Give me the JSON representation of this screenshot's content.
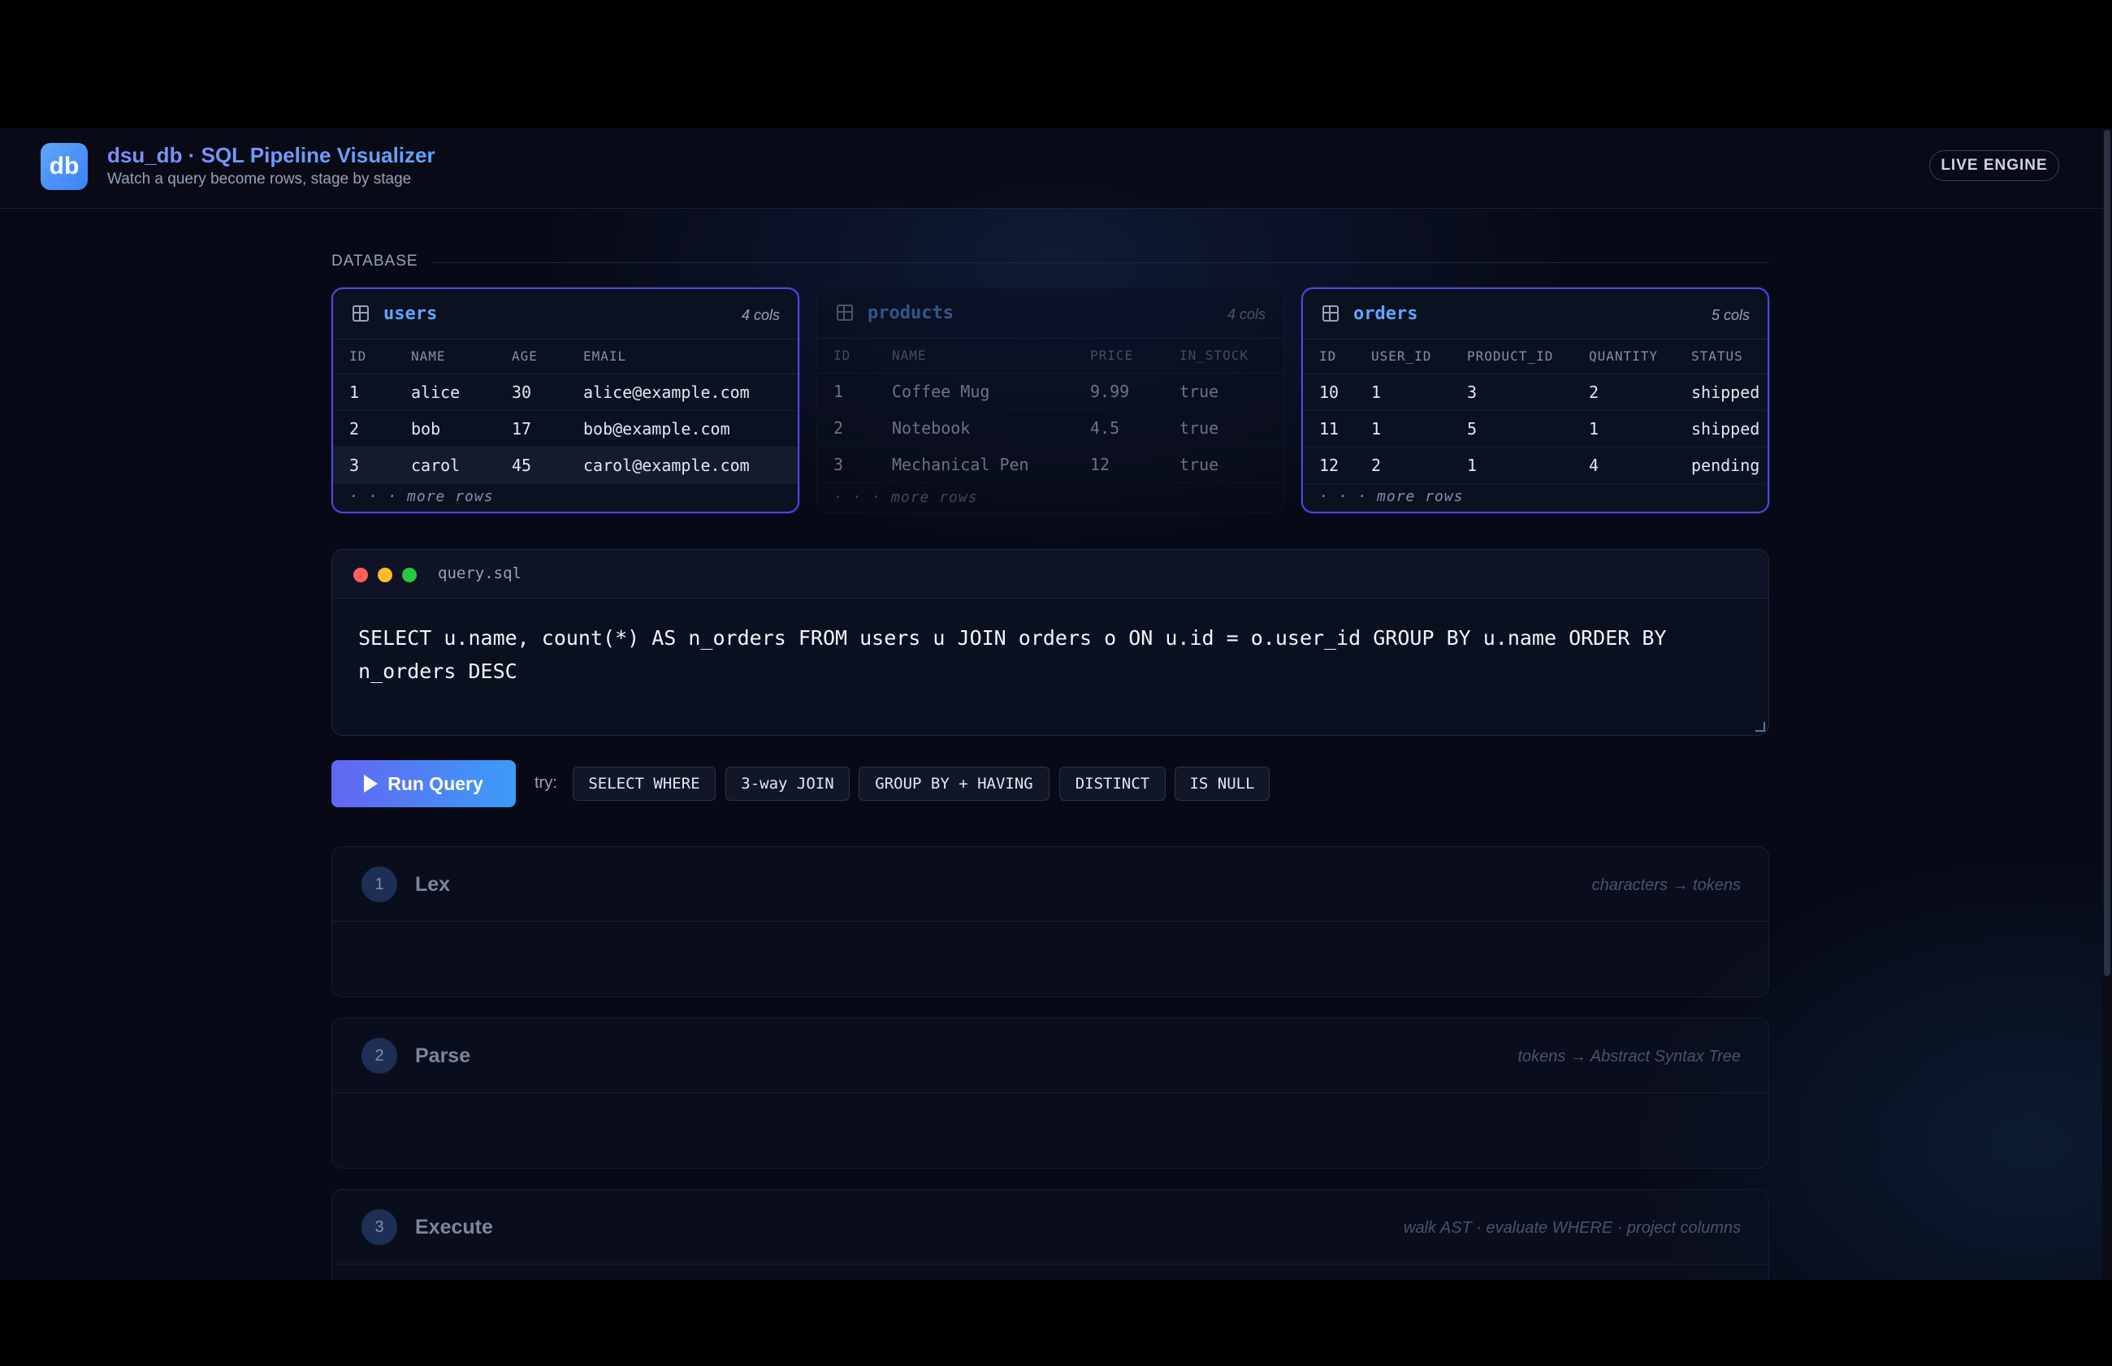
{
  "header": {
    "logo_text": "db",
    "title": "dsu_db · SQL Pipeline Visualizer",
    "subtitle": "Watch a query become rows, stage by stage",
    "badge": "LIVE ENGINE"
  },
  "database": {
    "label": "DATABASE",
    "tables": [
      {
        "name": "users",
        "cols_label": "4 cols",
        "columns": [
          "ID",
          "NAME",
          "AGE",
          "EMAIL"
        ],
        "rows": [
          [
            "1",
            "alice",
            "30",
            "alice@example.com"
          ],
          [
            "2",
            "bob",
            "17",
            "bob@example.com"
          ],
          [
            "3",
            "carol",
            "45",
            "carol@example.com"
          ]
        ],
        "more": "· · · more rows"
      },
      {
        "name": "products",
        "cols_label": "4 cols",
        "columns": [
          "ID",
          "NAME",
          "PRICE",
          "IN_STOCK"
        ],
        "rows": [
          [
            "1",
            "Coffee Mug",
            "9.99",
            "true"
          ],
          [
            "2",
            "Notebook",
            "4.5",
            "true"
          ],
          [
            "3",
            "Mechanical Pen",
            "12",
            "true"
          ]
        ],
        "more": "· · · more rows"
      },
      {
        "name": "orders",
        "cols_label": "5 cols",
        "columns": [
          "ID",
          "USER_ID",
          "PRODUCT_ID",
          "QUANTITY",
          "STATUS"
        ],
        "rows": [
          [
            "10",
            "1",
            "3",
            "2",
            "shipped"
          ],
          [
            "11",
            "1",
            "5",
            "1",
            "shipped"
          ],
          [
            "12",
            "2",
            "1",
            "4",
            "pending"
          ]
        ],
        "more": "· · · more rows"
      }
    ]
  },
  "editor": {
    "filename": "query.sql",
    "query": "SELECT u.name, count(*) AS n_orders FROM users u JOIN orders o ON u.id = o.user_id GROUP BY u.name ORDER BY\nn_orders DESC"
  },
  "actions": {
    "run_label": "Run Query",
    "try_label": "try:",
    "examples": [
      "SELECT WHERE",
      "3-way JOIN",
      "GROUP BY + HAVING",
      "DISTINCT",
      "IS NULL"
    ]
  },
  "stages": [
    {
      "num": "1",
      "title": "Lex",
      "desc": "characters → tokens"
    },
    {
      "num": "2",
      "title": "Parse",
      "desc": "tokens → Abstract Syntax Tree"
    },
    {
      "num": "3",
      "title": "Execute",
      "desc": "walk AST · evaluate WHERE · project columns"
    }
  ],
  "colors": {
    "accent": "#60a5fa",
    "indigo": "#6366f1",
    "mac_red": "#ff5f57",
    "mac_yellow": "#febc2e",
    "mac_green": "#28c840"
  }
}
